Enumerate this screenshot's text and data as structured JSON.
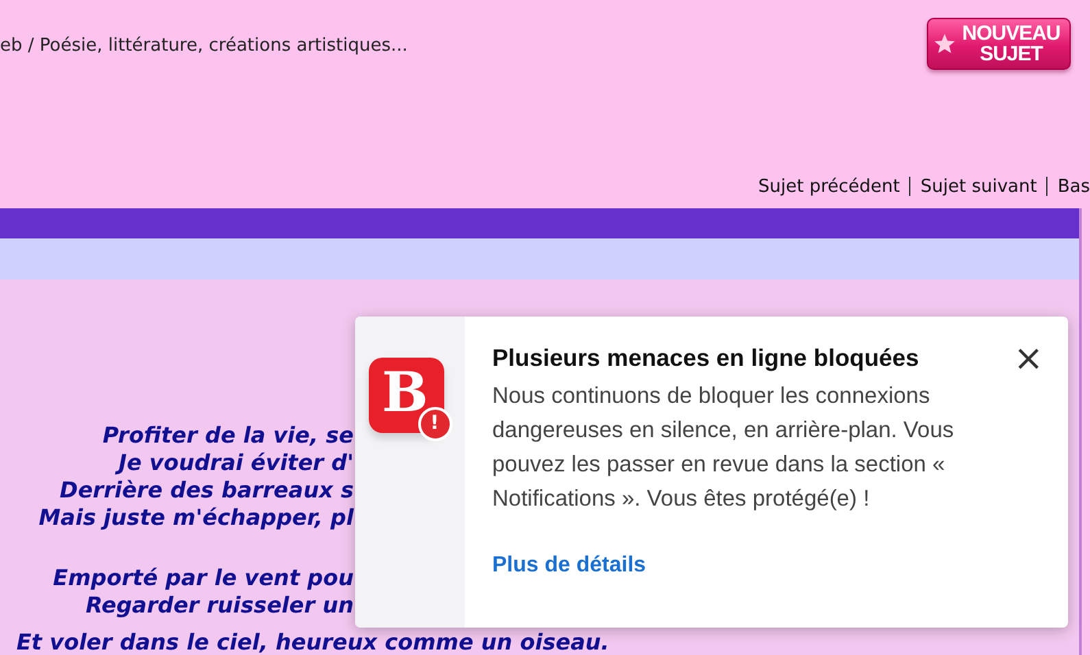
{
  "breadcrumb": "eb / Poésie, littérature, créations artistiques...",
  "new_topic_button": {
    "lines": [
      "NOUVEAU",
      "SUJET"
    ]
  },
  "topic_nav": [
    "Sujet précédent",
    "Sujet suivant",
    "Bas"
  ],
  "poem": {
    "stanzas": [
      [
        "Profiter de la vie, se",
        "Je voudrai éviter d'",
        "Derrière des barreaux s",
        "Mais juste m'échapper, pl"
      ],
      [
        "Emporté par le vent pou",
        "Regarder ruisseler un"
      ]
    ],
    "last_line": "Et voler dans le ciel, heureux comme un oiseau."
  },
  "notification": {
    "title": "Plusieurs menaces en ligne bloquées",
    "message": "Nous continuons de bloquer les connexions dangereuses en silence, en arrière-plan. Vous pouvez les passer en revue dans la section « Notifications ». Vous êtes protégé(e) !",
    "link": "Plus de détails",
    "app_icon_letter": "B",
    "badge": "!",
    "close": "×"
  }
}
